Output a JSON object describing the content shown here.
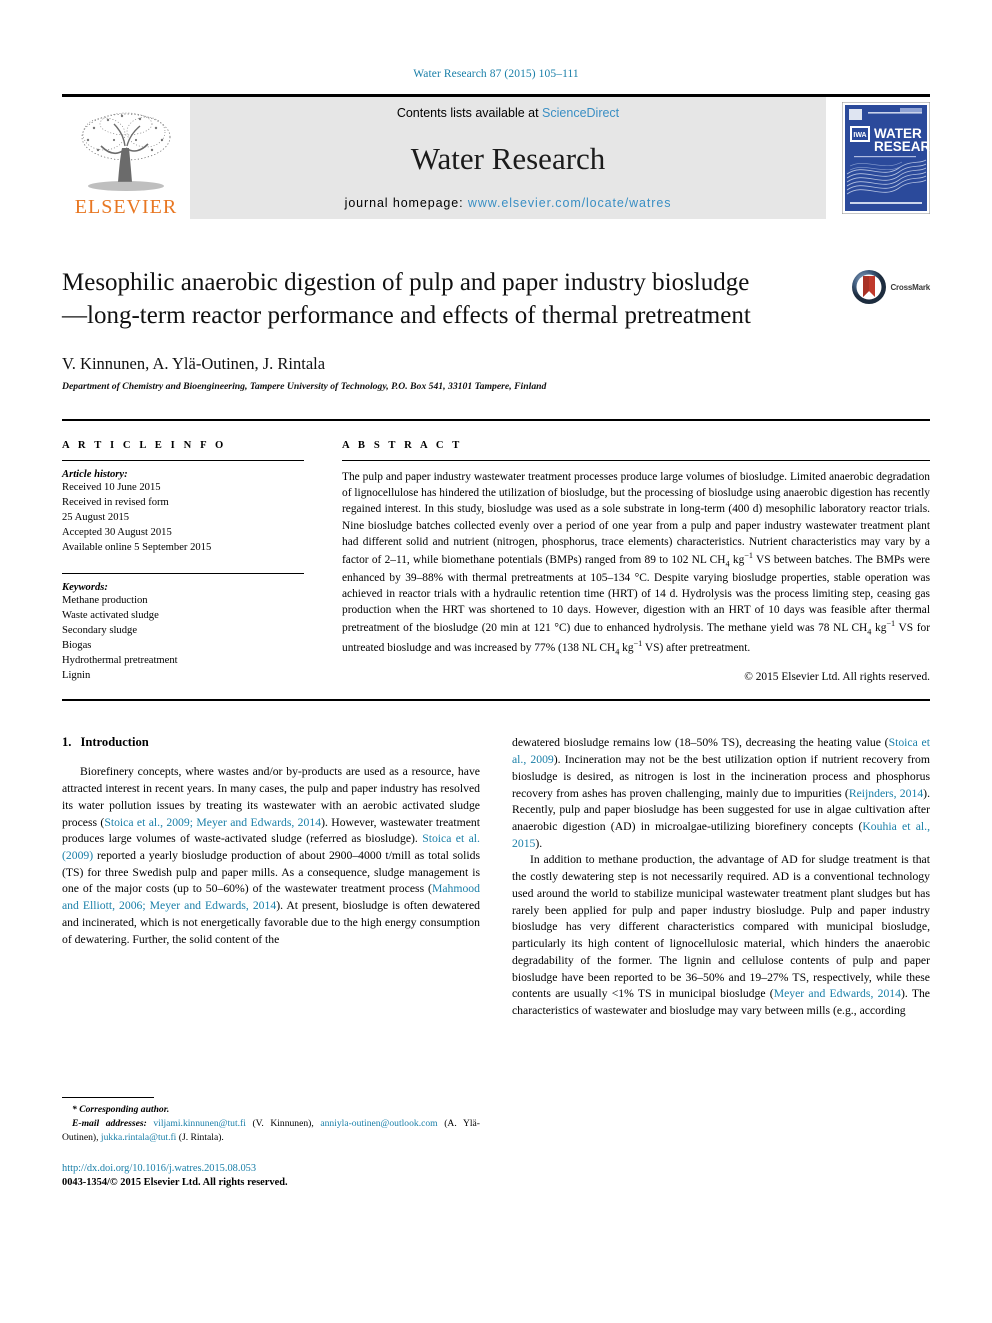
{
  "running_head": "Water Research 87 (2015) 105–111",
  "masthead": {
    "contents_prefix": "Contents lists available at ",
    "sciencedirect": "ScienceDirect",
    "journal_name": "Water Research",
    "homepage_prefix": "journal homepage: ",
    "homepage_url": "www.elsevier.com/locate/watres",
    "publisher": "ELSEVIER",
    "cover_title_line1": "WATER",
    "cover_title_line2": "RESEARCH",
    "cover_badge": "IWA"
  },
  "article": {
    "title": "Mesophilic anaerobic digestion of pulp and paper industry biosludge—long-term reactor performance and effects of thermal pretreatment",
    "authors": "V. Kinnunen, A. Ylä-Outinen, J. Rintala",
    "affiliation": "Department of Chemistry and Bioengineering, Tampere University of Technology, P.O. Box 541, 33101 Tampere, Finland",
    "crossmark_label": "CrossMark"
  },
  "article_info": {
    "heading": "A R T I C L E   I N F O",
    "history_label": "Article history:",
    "history": [
      "Received 10 June 2015",
      "Received in revised form",
      "25 August 2015",
      "Accepted 30 August 2015",
      "Available online 5 September 2015"
    ],
    "keywords_label": "Keywords:",
    "keywords": [
      "Methane production",
      "Waste activated sludge",
      "Secondary sludge",
      "Biogas",
      "Hydrothermal pretreatment",
      "Lignin"
    ]
  },
  "abstract": {
    "heading": "A B S T R A C T",
    "text": "The pulp and paper industry wastewater treatment processes produce large volumes of biosludge. Limited anaerobic degradation of lignocellulose has hindered the utilization of biosludge, but the processing of biosludge using anaerobic digestion has recently regained interest. In this study, biosludge was used as a sole substrate in long-term (400 d) mesophilic laboratory reactor trials. Nine biosludge batches collected evenly over a period of one year from a pulp and paper industry wastewater treatment plant had different solid and nutrient (nitrogen, phosphorus, trace elements) characteristics. Nutrient characteristics may vary by a factor of 2–11, while biomethane potentials (BMPs) ranged from 89 to 102 NL CH4 kg−1 VS between batches. The BMPs were enhanced by 39–88% with thermal pretreatments at 105–134 °C. Despite varying biosludge properties, stable operation was achieved in reactor trials with a hydraulic retention time (HRT) of 14 d. Hydrolysis was the process limiting step, ceasing gas production when the HRT was shortened to 10 days. However, digestion with an HRT of 10 days was feasible after thermal pretreatment of the biosludge (20 min at 121 °C) due to enhanced hydrolysis. The methane yield was 78 NL CH4 kg−1 VS for untreated biosludge and was increased by 77% (138 NL CH4 kg−1 VS) after pretreatment.",
    "copyright": "© 2015 Elsevier Ltd. All rights reserved."
  },
  "section": {
    "number": "1.",
    "title": "Introduction"
  },
  "body": {
    "left_paragraph_1_parts": [
      "Biorefinery concepts, where wastes and/or by-products are used as a resource, have attracted interest in recent years. In many cases, the pulp and paper industry has resolved its water pollution issues by treating its wastewater with an aerobic activated sludge process (",
      "Stoica et al., 2009; Meyer and Edwards, 2014",
      "). However, wastewater treatment produces large volumes of waste-activated sludge (referred as biosludge). ",
      "Stoica et al. (2009)",
      " reported a yearly biosludge production of about 2900–4000 t/mill as total solids (TS) for three Swedish pulp and paper mills. As a consequence, sludge management is one of the major costs (up to 50–60%) of the wastewater treatment process (",
      "Mahmood and Elliott, 2006; Meyer and Edwards, 2014",
      "). At present, biosludge is often dewatered and incinerated, which is not energetically favorable due to the high energy consumption of dewatering. Further, the solid content of the"
    ],
    "right_paragraph_1_parts": [
      "dewatered biosludge remains low (18–50% TS), decreasing the heating value (",
      "Stoica et al., 2009",
      "). Incineration may not be the best utilization option if nutrient recovery from biosludge is desired, as nitrogen is lost in the incineration process and phosphorus recovery from ashes has proven challenging, mainly due to impurities (",
      "Reijnders, 2014",
      "). Recently, pulp and paper biosludge has been suggested for use in algae cultivation after anaerobic digestion (AD) in microalgae-utilizing biorefinery concepts (",
      "Kouhia et al., 2015",
      ")."
    ],
    "right_paragraph_2_parts": [
      "In addition to methane production, the advantage of AD for sludge treatment is that the costly dewatering step is not necessarily required. AD is a conventional technology used around the world to stabilize municipal wastewater treatment plant sludges but has rarely been applied for pulp and paper industry biosludge. Pulp and paper industry biosludge has very different characteristics compared with municipal biosludge, particularly its high content of lignocellulosic material, which hinders the anaerobic degradability of the former. The lignin and cellulose contents of pulp and paper biosludge have been reported to be 36–50% and 19–27% TS, respectively, while these contents are usually <1% TS in municipal biosludge (",
      "Meyer and Edwards, 2014",
      "). The characteristics of wastewater and biosludge may vary between mills (e.g., according"
    ]
  },
  "footnote": {
    "corresponding_marker": "*",
    "corresponding_label": "Corresponding author.",
    "email_label": "E-mail addresses:",
    "emails": [
      {
        "address": "viljami.kinnunen@tut.fi",
        "person": "(V. Kinnunen)"
      },
      {
        "address": "anniyla-outinen@outlook.com",
        "person": "(A. Ylä-Outinen)"
      },
      {
        "address": "jukka.rintala@tut.fi",
        "person": "(J. Rintala)"
      }
    ],
    "doi": "http://dx.doi.org/10.1016/j.watres.2015.08.053",
    "issn_line": "0043-1354/© 2015 Elsevier Ltd. All rights reserved."
  },
  "colors": {
    "link": "#1a7fa8",
    "sciencedirect": "#3a8fc4",
    "elsevier_orange": "#e87722",
    "cover_blue": "#2b4a9b"
  }
}
